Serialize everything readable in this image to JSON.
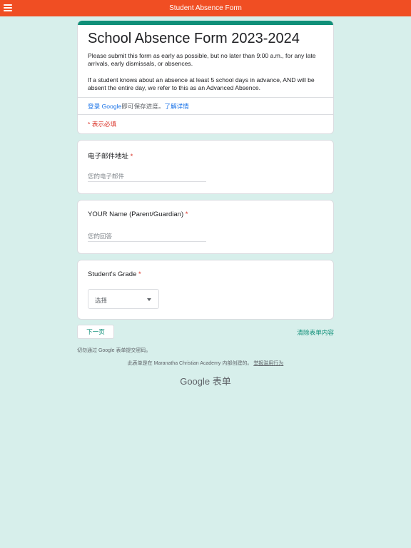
{
  "topbar": {
    "title": "Student Absence Form",
    "menu_icon": "hamburger-menu-icon"
  },
  "header": {
    "title": "School Absence Form 2023-2024",
    "description_1": "Please submit this form as early as possible, but no later than 9:00 a.m., for any late arrivals, early dismissals, or absences.",
    "description_2": "If a student knows about an absence at least 5 school days in advance, AND will be absent the entire day, we refer to this as an Advanced Absence.",
    "signin_link": "登录 Google",
    "signin_text": "即可保存进度。",
    "learn_more": "了解详情",
    "required_note": "* 表示必填"
  },
  "questions": [
    {
      "label": "电子邮件地址",
      "required_mark": "*",
      "placeholder": "您的电子邮件"
    },
    {
      "label": "YOUR Name (Parent/Guardian)",
      "required_mark": "*",
      "placeholder": "您的回答"
    },
    {
      "label": "Student's Grade",
      "required_mark": "*",
      "select_value": "选择"
    }
  ],
  "actions": {
    "next": "下一页",
    "clear": "清除表单内容"
  },
  "footer": {
    "password_note": "切勿通过 Google 表单提交密码。",
    "created_in": "此表单是在 Maranatha Christian Academy 内部创建的。",
    "report_abuse": "举报滥用行为",
    "brand": "Google 表单"
  },
  "colors": {
    "topbar": "#f04e23",
    "accent": "#0f8f78",
    "background": "#d7efeb",
    "required": "#d93025",
    "link": "#1a73e8"
  }
}
